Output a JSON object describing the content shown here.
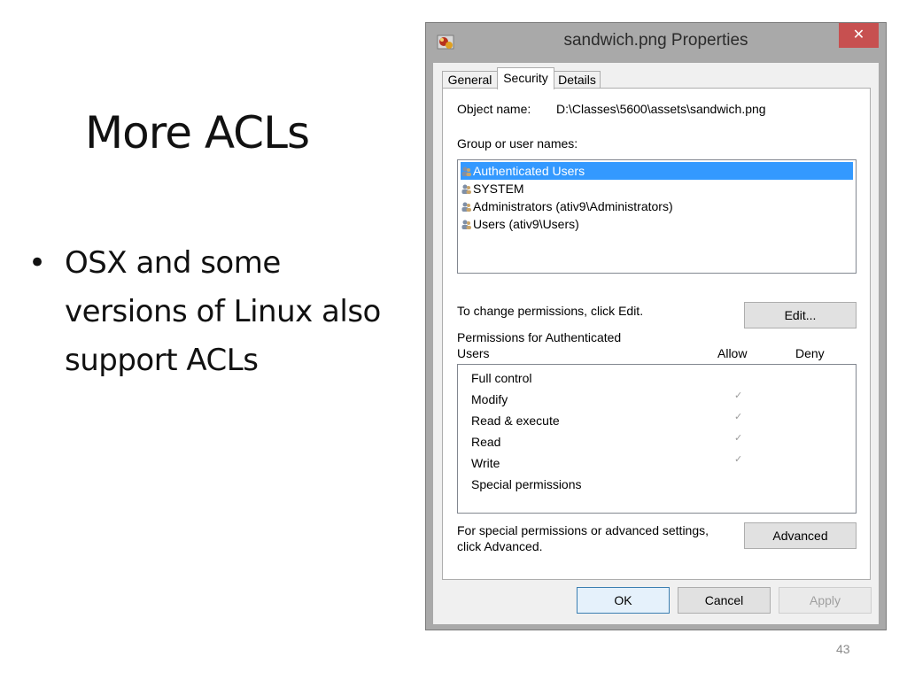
{
  "slide": {
    "title": "More ACLs",
    "bullets": [
      "OSX and some versions of Linux also support ACLs"
    ],
    "page_number": "43"
  },
  "dialog": {
    "title": "sandwich.png Properties",
    "close_glyph": "✕",
    "tabs": [
      {
        "label": "General",
        "active": false
      },
      {
        "label": "Security",
        "active": true
      },
      {
        "label": "Details",
        "active": false
      }
    ],
    "object_name_label": "Object name:",
    "object_name_value": "D:\\Classes\\5600\\assets\\sandwich.png",
    "group_label": "Group or user names:",
    "users": [
      {
        "label": "Authenticated Users",
        "selected": true
      },
      {
        "label": "SYSTEM",
        "selected": false
      },
      {
        "label": "Administrators (ativ9\\Administrators)",
        "selected": false
      },
      {
        "label": "Users (ativ9\\Users)",
        "selected": false
      }
    ],
    "change_text": "To change permissions, click Edit.",
    "edit_button": "Edit...",
    "permissions_for_line1": "Permissions for Authenticated",
    "permissions_for_line2": "Users",
    "allow_header": "Allow",
    "deny_header": "Deny",
    "permissions": [
      {
        "label": "Full control",
        "allow": false
      },
      {
        "label": "Modify",
        "allow": true
      },
      {
        "label": "Read & execute",
        "allow": true
      },
      {
        "label": "Read",
        "allow": true
      },
      {
        "label": "Write",
        "allow": true
      },
      {
        "label": "Special permissions",
        "allow": false
      }
    ],
    "check_glyph": "✓",
    "special_text_line1": "For special permissions or advanced settings,",
    "special_text_line2": "click Advanced.",
    "advanced_button": "Advanced",
    "ok_button": "OK",
    "cancel_button": "Cancel",
    "apply_button": "Apply"
  },
  "colors": {
    "selection": "#3399ff",
    "close": "#c75050",
    "ok_border": "#3c7fb1"
  }
}
